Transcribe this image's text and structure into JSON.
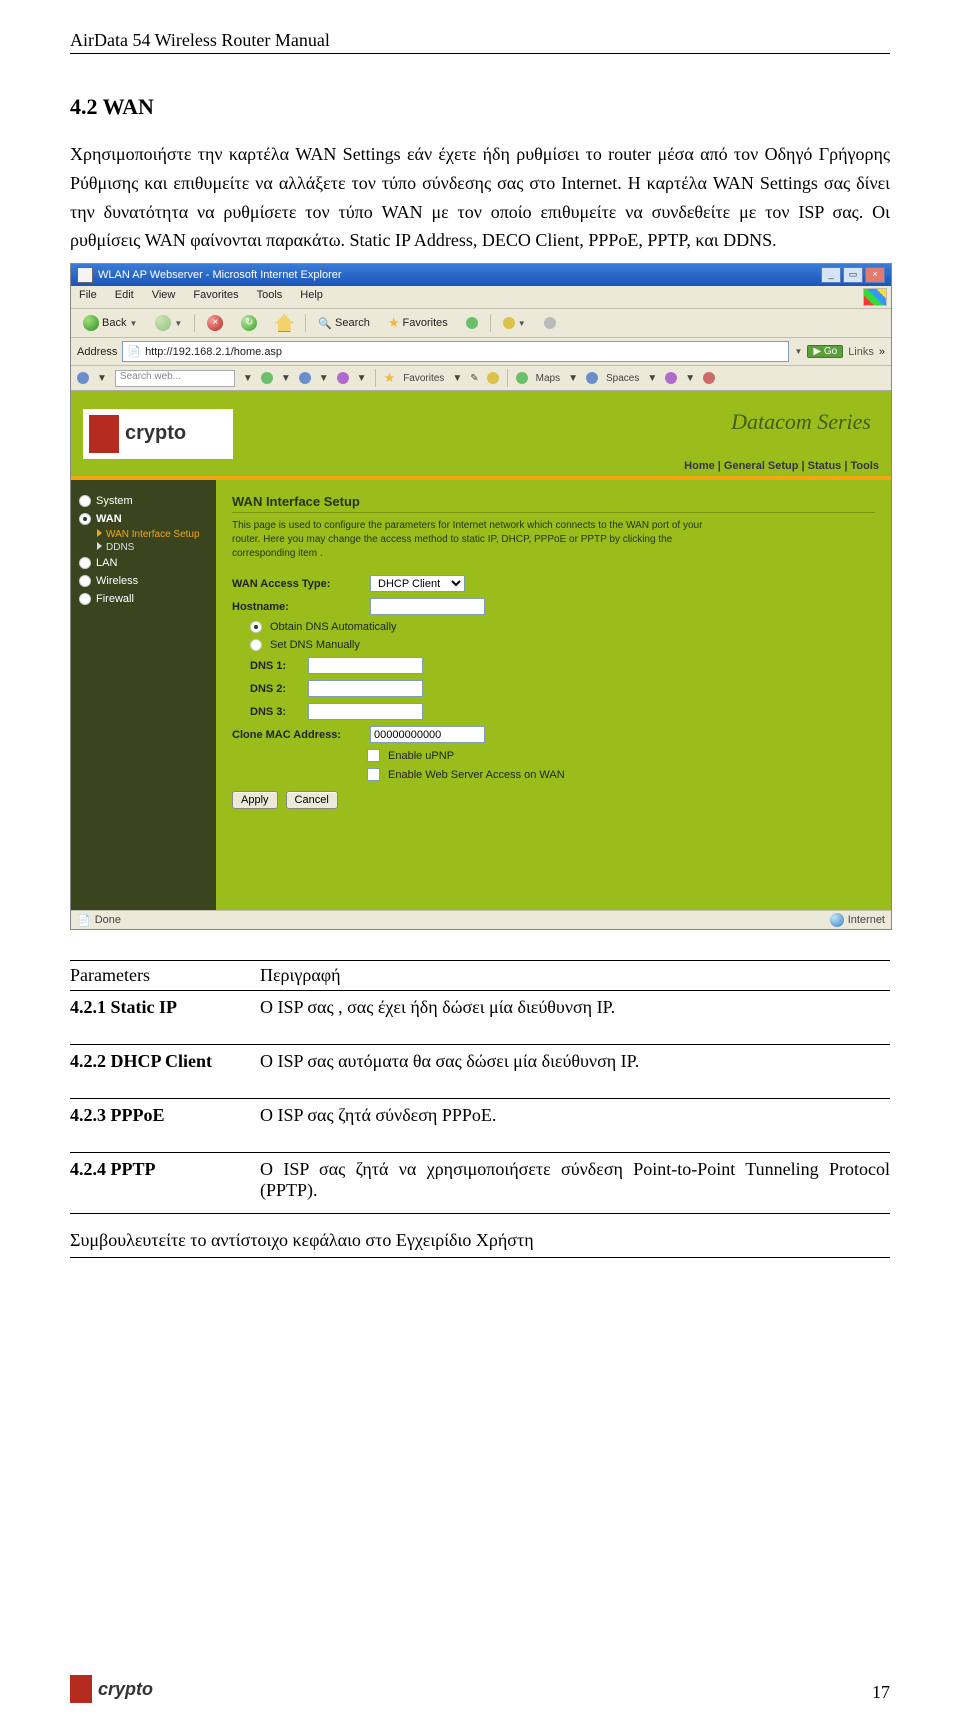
{
  "doc": {
    "header": "AirData 54 Wireless Router Manual",
    "section_heading": "4.2 WAN",
    "paragraph": "Χρησιμοποιήστε την καρτέλα WAN Settings εάν έχετε ήδη ρυθμίσει το router μέσα από τον Οδηγό Γρήγορης Ρύθμισης και επιθυμείτε να αλλάξετε τον τύπο σύνδεσης σας στο Internet. Η καρτέλα WAN Settings σας δίνει την δυνατότητα να ρυθμίσετε τον τύπο WAN με τον οποίο επιθυμείτε να συνδεθείτε με τον ISP σας. Οι ρυθμίσεις WAN φαίνονται παρακάτω. Static IP Address, DECO Client, PPPoE, PPTP, και DDNS.",
    "param_head_left": "Parameters",
    "param_head_right": "Περιγραφή",
    "params": {
      "p1_name": "4.2.1 Static IP",
      "p1_desc": "Ο ISP σας , σας έχει ήδη δώσει μία διεύθυνση IP.",
      "p2_name": "4.2.2 DHCP Client",
      "p2_desc": "Ο ISP σας αυτόματα θα σας δώσει μία διεύθυνση IP.",
      "p3_name": "4.2.3 PPPoE",
      "p3_desc": "Ο ISP σας ζητά σύνδεση PPPoE.",
      "p4_name": "4.2.4 PPTP",
      "p4_desc": "Ο ISP σας ζητά να χρησιμοποιήσετε σύνδεση Point-to-Point Tunneling Protocol (PPTP)."
    },
    "tail_note": "Συμβουλευτείτε το αντίστοιχο κεφάλαιο στο Εγχειρίδιο Χρήστη",
    "footer_logo": "crypto",
    "page_number": "17"
  },
  "ie": {
    "title": "WLAN AP Webserver - Microsoft Internet Explorer",
    "menu": {
      "file": "File",
      "edit": "Edit",
      "view": "View",
      "fav": "Favorites",
      "tools": "Tools",
      "help": "Help"
    },
    "toolbar": {
      "back": "Back",
      "search": "Search",
      "favorites": "Favorites"
    },
    "address_label": "Address",
    "address_value": "http://192.168.2.1/home.asp",
    "go": "Go",
    "links": "Links",
    "search_placeholder": "Search web...",
    "extra": {
      "fav": "Favorites",
      "maps": "Maps",
      "spaces": "Spaces"
    },
    "status_done": "Done",
    "status_zone": "Internet"
  },
  "router": {
    "logo": "crypto",
    "series": "Datacom Series",
    "topnav": "Home | General Setup | Status | Tools",
    "side": {
      "system": "System",
      "wan": "WAN",
      "wan_sub1": "WAN Interface Setup",
      "wan_sub2": "DDNS",
      "lan": "LAN",
      "wireless": "Wireless",
      "firewall": "Firewall"
    },
    "form": {
      "heading": "WAN Interface Setup",
      "intro": "This page is used to configure the parameters for Internet network which connects to the WAN port of your router. Here you may change the access method to static IP, DHCP, PPPoE or PPTP by clicking the corresponding item .",
      "access_label": "WAN Access Type:",
      "access_value": "DHCP Client",
      "hostname": "Hostname:",
      "dns_auto": "Obtain DNS Automatically",
      "dns_manual": "Set DNS Manually",
      "dns1": "DNS 1:",
      "dns2": "DNS 2:",
      "dns3": "DNS 3:",
      "clone_label": "Clone MAC Address:",
      "clone_value": "00000000000",
      "upnp": "Enable uPNP",
      "webwan": "Enable Web Server Access on WAN",
      "apply": "Apply",
      "cancel": "Cancel"
    }
  }
}
